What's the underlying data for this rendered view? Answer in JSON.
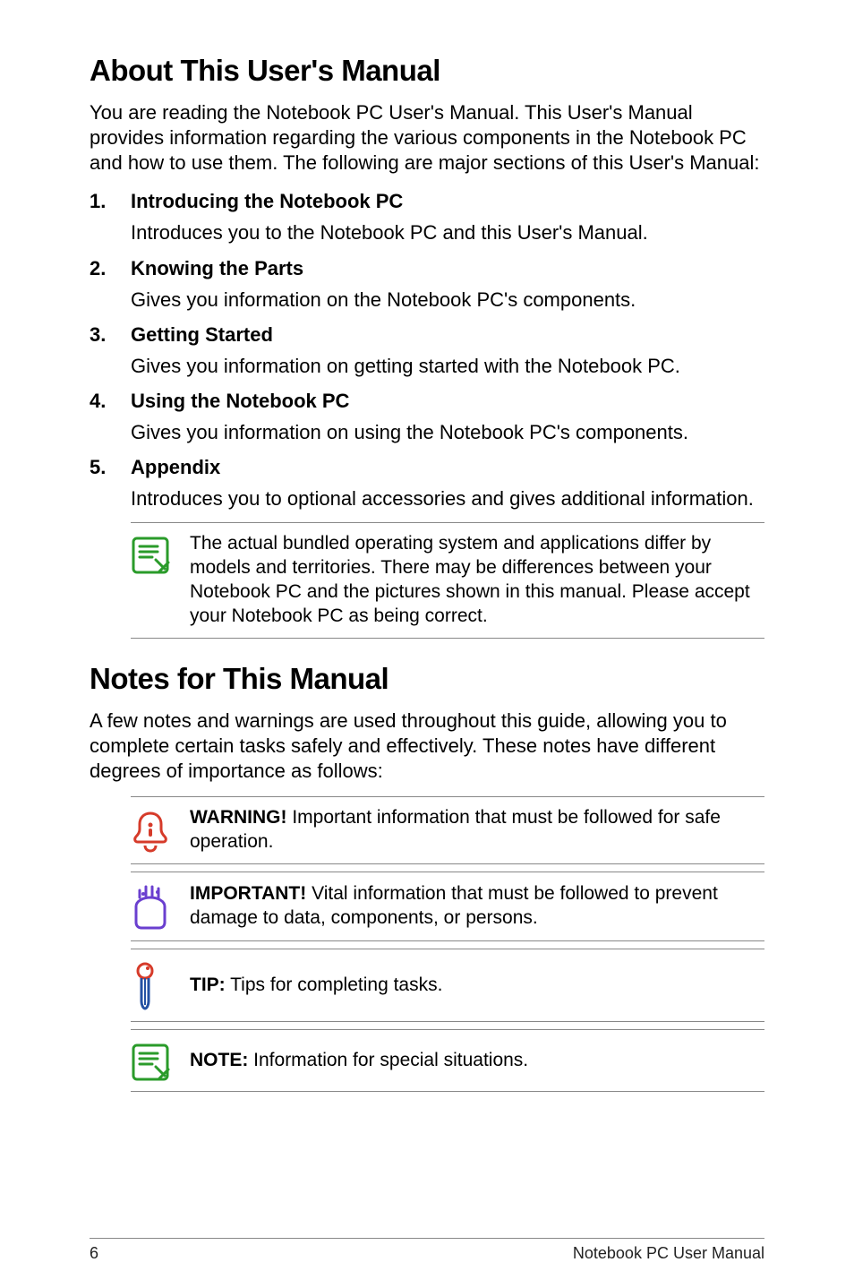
{
  "heading1": "About This User's Manual",
  "intro": "You are reading the Notebook PC User's Manual. This User's Manual provides information regarding the various components in the Notebook PC and how to use them. The following are major sections of this User's Manual:",
  "sections": [
    {
      "title": "Introducing the Notebook PC",
      "desc": "Introduces you to the Notebook PC and this User's Manual."
    },
    {
      "title": "Knowing the Parts",
      "desc": "Gives you information on the Notebook PC's components."
    },
    {
      "title": "Getting Started",
      "desc": "Gives you information on getting started with the Notebook PC."
    },
    {
      "title": "Using the Notebook PC",
      "desc": "Gives you information on using the Notebook PC's components."
    },
    {
      "title": "Appendix",
      "desc": "Introduces you to optional accessories and gives additional information."
    }
  ],
  "disclaimer": "The actual bundled operating system and applications differ by models and territories. There may be differences between your Notebook PC and the pictures shown in this manual. Please accept your Notebook PC as being correct.",
  "heading2": "Notes for This Manual",
  "notes_intro": "A few notes and warnings are used throughout this guide, allowing you to complete certain tasks safely and effectively. These notes have different degrees of importance as follows:",
  "notices": [
    {
      "label": "WARNING!",
      "text": " Important information that must be followed for safe operation.",
      "icon": "warning-icon"
    },
    {
      "label": "IMPORTANT!",
      "text": " Vital information that must be followed to prevent damage to data, components, or persons.",
      "icon": "important-icon"
    },
    {
      "label": "TIP:",
      "text": " Tips for completing tasks.",
      "icon": "tip-icon"
    },
    {
      "label": "NOTE:",
      "text": "  Information for special situations.",
      "icon": "note-icon"
    }
  ],
  "footer": {
    "page": "6",
    "text": "Notebook PC User Manual"
  },
  "icons": {
    "note-icon": "note",
    "warning-icon": "warning",
    "important-icon": "important",
    "tip-icon": "tip"
  }
}
